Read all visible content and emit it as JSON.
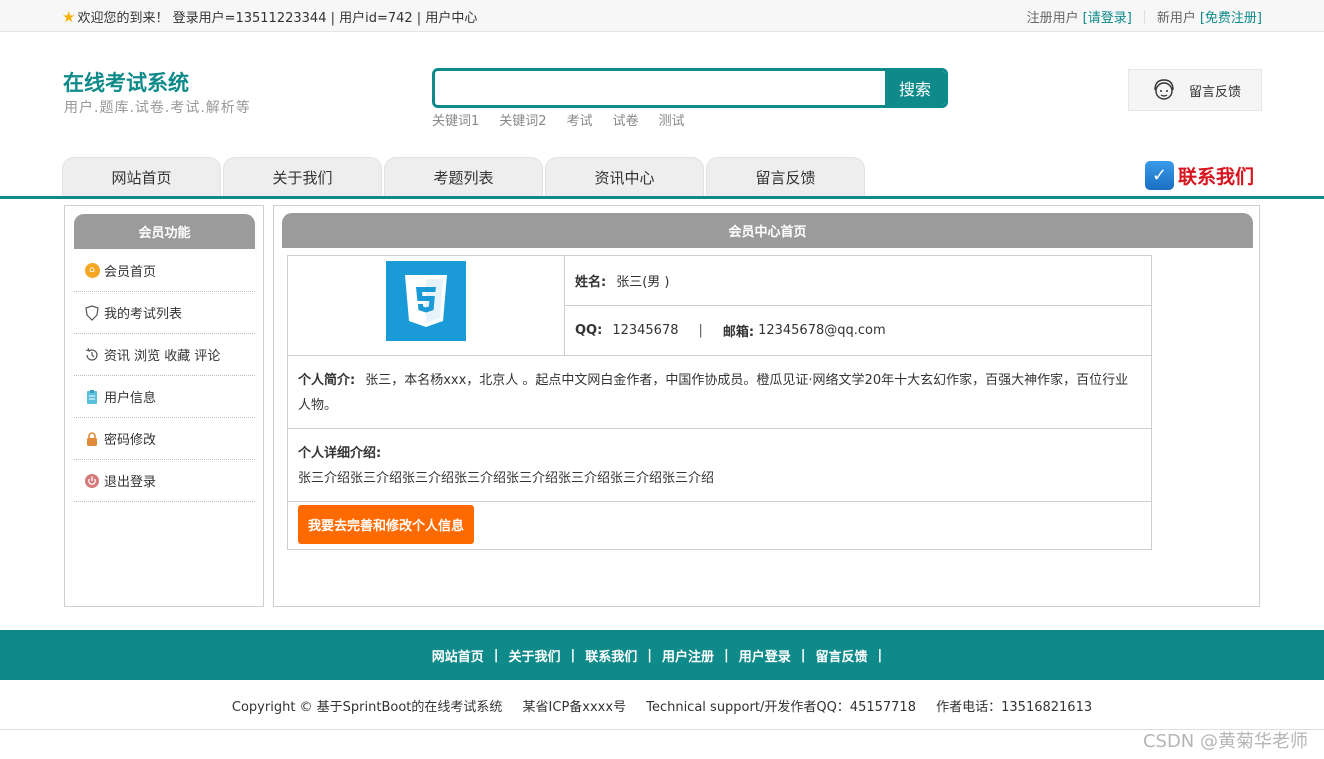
{
  "topbar": {
    "welcome": "欢迎您的到来！ 登录用户=13511223344 | 用户id=742 | 用户中心",
    "registered_label": "注册用户",
    "login_link": "[请登录]",
    "new_user_label": "新用户",
    "register_link": "[免费注册]"
  },
  "header": {
    "site_title": "在线考试系统",
    "site_subtitle": "用户.题库.试卷.考试.解析等",
    "search_placeholder": "",
    "search_button": "搜索",
    "keywords": [
      "关键词1",
      "关键词2",
      "考试",
      "试卷",
      "测试"
    ],
    "feedback_label": "留言反馈"
  },
  "nav": {
    "tabs": [
      "网站首页",
      "关于我们",
      "考题列表",
      "资讯中心",
      "留言反馈"
    ],
    "contact_label": "联系我们"
  },
  "sidebar": {
    "title": "会员功能",
    "items": [
      {
        "label": "会员首页",
        "icon": "home-icon"
      },
      {
        "label": "我的考试列表",
        "icon": "shield-icon"
      },
      {
        "label": "资讯 浏览 收藏 评论",
        "icon": "history-icon"
      },
      {
        "label": "用户信息",
        "icon": "clipboard-icon"
      },
      {
        "label": "密码修改",
        "icon": "lock-icon"
      },
      {
        "label": "退出登录",
        "icon": "power-icon"
      }
    ]
  },
  "main": {
    "title": "会员中心首页",
    "name_label": "姓名:",
    "name_value": "张三(男 )",
    "qq_label": "QQ:",
    "qq_value": "12345678",
    "email_label": "邮箱:",
    "email_value": "12345678@qq.com",
    "intro_label": "个人简介:",
    "intro_value": "张三，本名杨xxx，北京人 。起点中文网白金作者，中国作协成员。橙瓜见证·网络文学20年十大玄幻作家，百强大神作家，百位行业人物。",
    "detail_label": "个人详细介绍:",
    "detail_value": "张三介绍张三介绍张三介绍张三介绍张三介绍张三介绍张三介绍张三介绍",
    "edit_button": "我要去完善和修改个人信息"
  },
  "footer": {
    "links": [
      "网站首页",
      "关于我们",
      "联系我们",
      "用户注册",
      "用户登录",
      "留言反馈"
    ],
    "copyright": "Copyright © 基于SprintBoot的在线考试系统",
    "icp": "某省ICP备xxxx号",
    "support": "Technical support/开发作者QQ：45157718",
    "phone": "作者电话：13516821613"
  },
  "watermark": "CSDN @黄菊华老师",
  "colors": {
    "accent": "#0e8a8a",
    "button": "#ff6a00",
    "panel_head": "#9b9b9b",
    "contact": "#d6141d"
  }
}
